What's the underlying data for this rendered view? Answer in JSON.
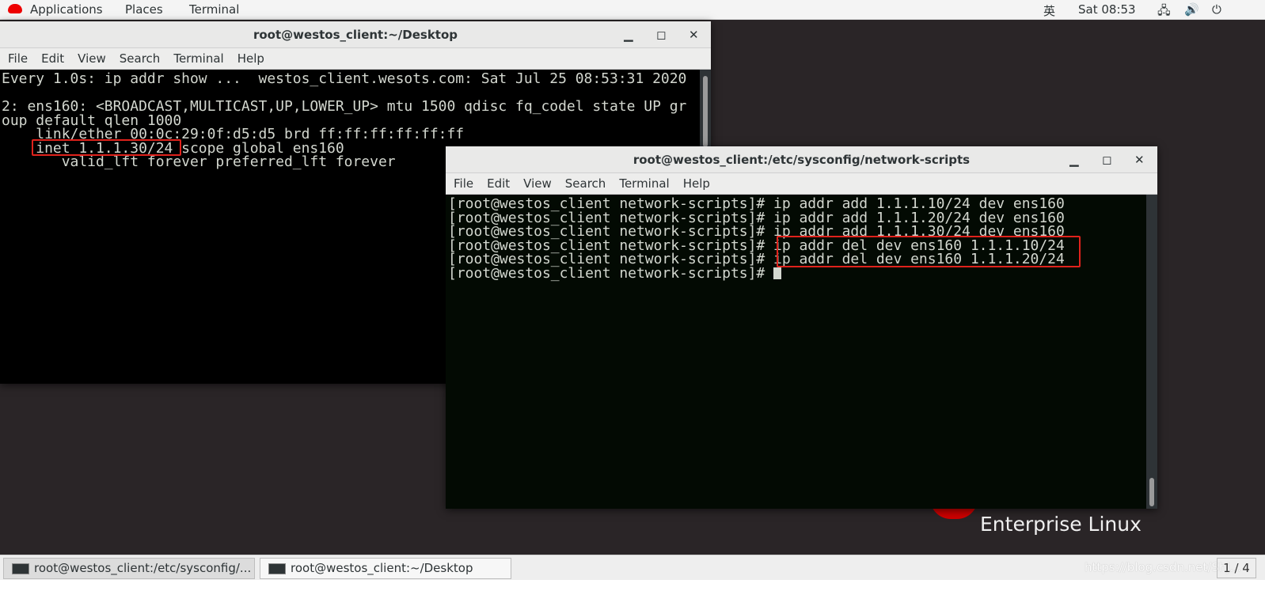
{
  "topbar": {
    "applications": "Applications",
    "places": "Places",
    "terminal": "Terminal",
    "input_method": "英",
    "clock": "Sat 08:53",
    "brand_color": "#ee0000"
  },
  "menu": [
    "File",
    "Edit",
    "View",
    "Search",
    "Terminal",
    "Help"
  ],
  "window1": {
    "title": "root@westos_client:~/Desktop",
    "lines": [
      "Every 1.0s: ip addr show ...  westos_client.wesots.com: Sat Jul 25 08:53:31 2020",
      "",
      "2: ens160: <BROADCAST,MULTICAST,UP,LOWER_UP> mtu 1500 qdisc fq_codel state UP gr",
      "oup default qlen 1000",
      "    link/ether 00:0c:29:0f:d5:d5 brd ff:ff:ff:ff:ff:ff",
      "    inet 1.1.1.30/24 scope global ens160",
      "       valid_lft forever preferred_lft forever"
    ]
  },
  "window2": {
    "title": "root@westos_client:/etc/sysconfig/network-scripts",
    "lines": [
      "[root@westos_client network-scripts]# ip addr add 1.1.1.10/24 dev ens160",
      "[root@westos_client network-scripts]# ip addr add 1.1.1.20/24 dev ens160",
      "[root@westos_client network-scripts]# ip addr add 1.1.1.30/24 dev ens160",
      "[root@westos_client network-scripts]# ip addr del dev ens160 1.1.1.10/24",
      "[root@westos_client network-scripts]# ip addr del dev ens160 1.1.1.20/24",
      "[root@westos_client network-scripts]# "
    ]
  },
  "desktop": {
    "logo_text": "Enterprise Linux"
  },
  "taskbar": {
    "task1": "root@westos_client:/etc/sysconfig/...",
    "task2": "root@westos_client:~/Desktop",
    "workspace": "1 / 4",
    "watermark": "https://blog.csdn.net/Shj..."
  },
  "highlight_color": "#e0221c"
}
